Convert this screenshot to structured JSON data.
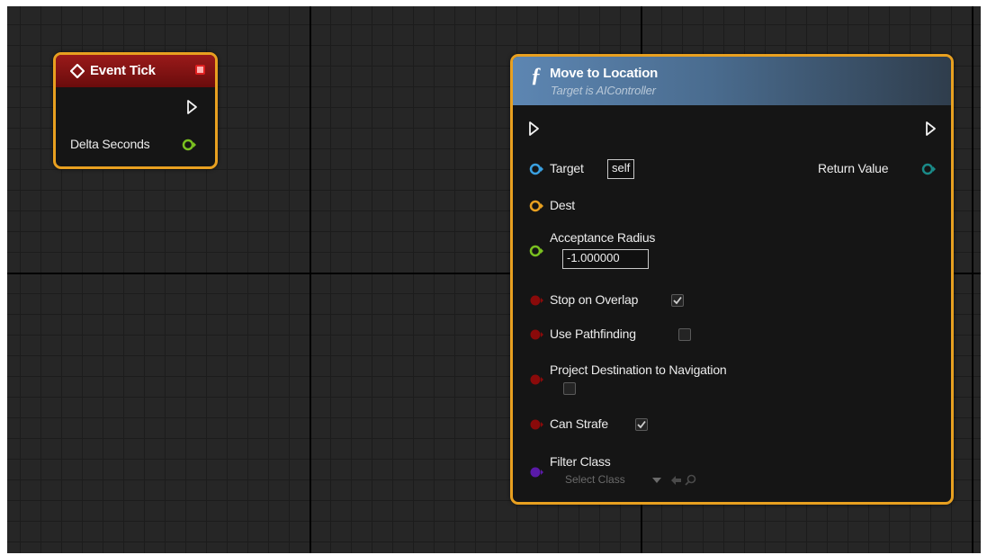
{
  "event_tick_node": {
    "title": "Event Tick",
    "output_pin_label": "Delta Seconds",
    "header_color": "#8a1414",
    "outline_color": "#e8a020"
  },
  "move_node": {
    "title": "Move to Location",
    "subtitle": "Target is AIController",
    "header_color": "#5a7fa6",
    "icon": "function-icon",
    "inputs": {
      "target": {
        "label": "Target",
        "value": "self",
        "pin_color": "#3aa0e0"
      },
      "dest": {
        "label": "Dest",
        "pin_color": "#e8a020"
      },
      "acceptance_radius": {
        "label": "Acceptance Radius",
        "value": "-1.000000",
        "pin_color": "#7ac020"
      },
      "stop_on_overlap": {
        "label": "Stop on Overlap",
        "checked": true,
        "pin_color": "#8a0a0a"
      },
      "use_pathfinding": {
        "label": "Use Pathfinding",
        "checked": false,
        "pin_color": "#8a0a0a"
      },
      "project_destination": {
        "label": "Project Destination to Navigation",
        "checked": false,
        "pin_color": "#8a0a0a"
      },
      "can_strafe": {
        "label": "Can Strafe",
        "checked": true,
        "pin_color": "#8a0a0a"
      },
      "filter_class": {
        "label": "Filter Class",
        "value": "Select Class",
        "pin_color": "#5a1aa8"
      }
    },
    "outputs": {
      "return_value": {
        "label": "Return Value",
        "pin_color": "#1a8a88"
      }
    }
  }
}
